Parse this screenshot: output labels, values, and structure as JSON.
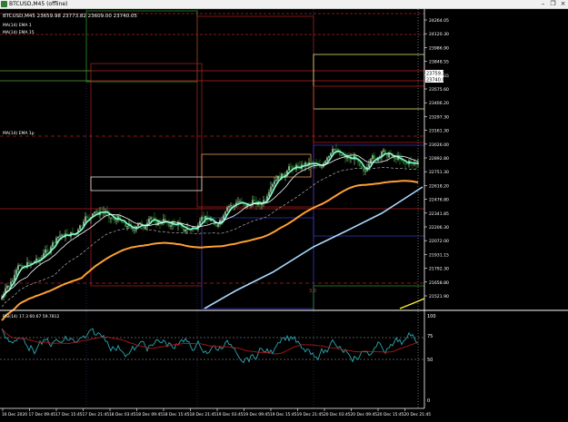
{
  "window": {
    "title": "BTCUSD,M45 (offline)"
  },
  "chart": {
    "info_line": "BTCUSD,M45  23659.98 23773.82 23609.00 23740.05",
    "ind_label_1": "MA(14) EMA 1",
    "ind_label_2": "MA(14) EMA 15",
    "ind_label_3": "MA(14) EMA 1p",
    "sub_label": "RSI(14) 17.3 60.67 59.7812",
    "price_labels": [
      "24264.05",
      "24120.30",
      "23986.90",
      "23848.55",
      "23740.05",
      "23575.60",
      "23406.20",
      "23297.30",
      "23161.30",
      "23026.00",
      "22892.80",
      "22751.30",
      "22618.20",
      "22476.80",
      "22341.85",
      "22206.30",
      "22072.00",
      "21931.15",
      "21792.30",
      "21658.80",
      "21521.90"
    ],
    "price_tags": [
      "23759.35",
      "23740.05"
    ],
    "rsi_scale": [
      "100",
      "75",
      "50",
      "0"
    ],
    "time_labels": [
      "16 Dec 2020",
      "17 Dec 09:45",
      "17 Dec 15:45",
      "17 Dec 21:45",
      "18 Dec 03:45",
      "18 Dec 09:45",
      "18 Dec 15:45",
      "18 Dec 21:45",
      "19 Dec 03:45",
      "19 Dec 09:45",
      "19 Dec 15:45",
      "19 Dec 21:45",
      "20 Dec 03:45",
      "20 Dec 09:45",
      "20 Dec 15:45",
      "20 Dec 21:45"
    ],
    "small_marker": "3.3",
    "colors": {
      "bull": "#b6f0b6",
      "bear": "#2e9e2e",
      "fast_ma": "#7fffd4",
      "mid_ma": "#ffffff",
      "slow_ma": "#ffa033",
      "long_ma": "#a8d8ff",
      "rsi": "#2aa7b0",
      "rsi_ma": "#b01818"
    }
  }
}
